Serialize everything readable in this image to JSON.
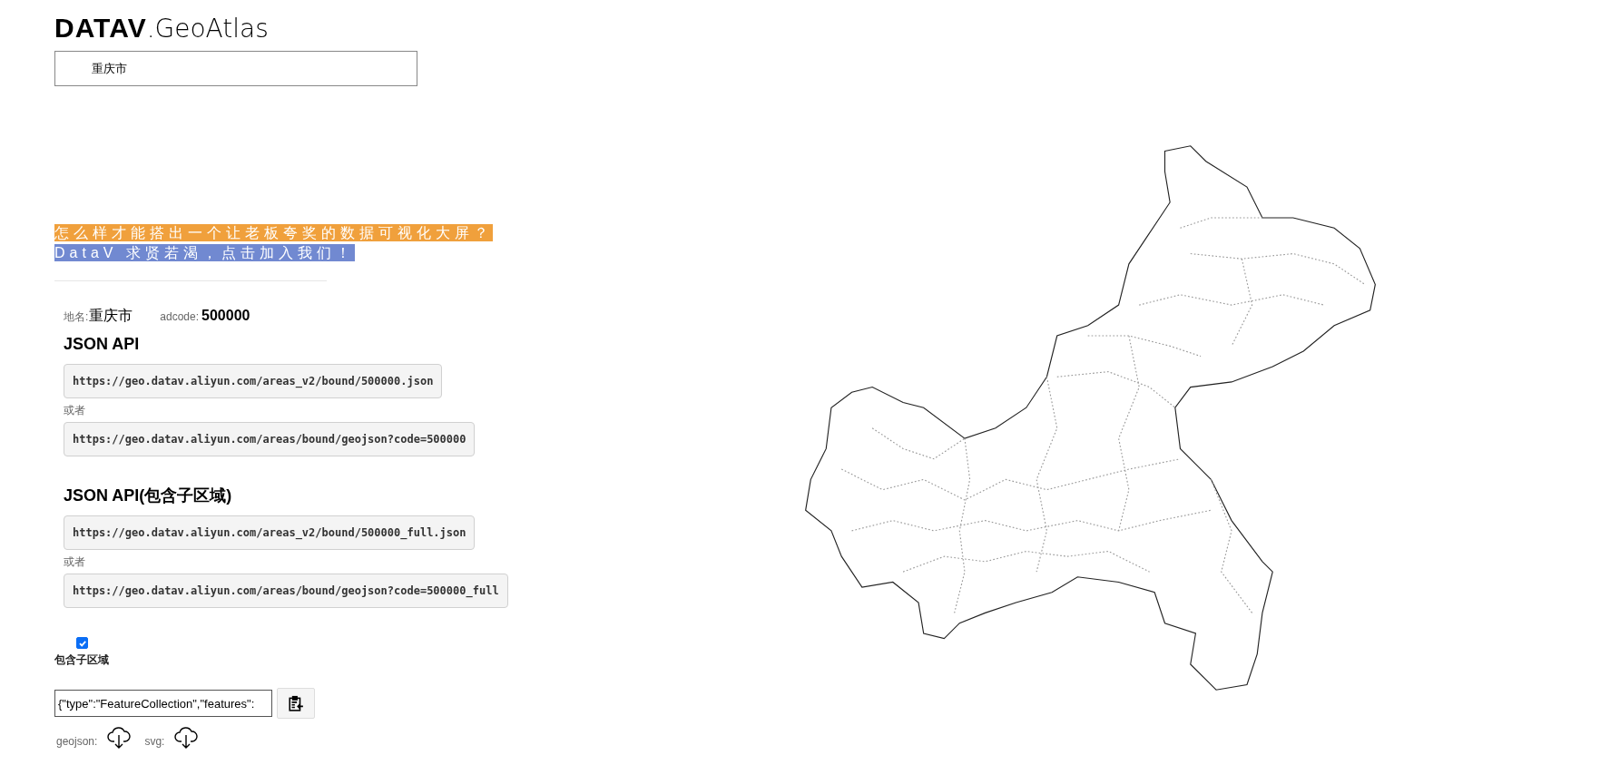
{
  "logo": {
    "bold": "DATAV",
    "light": ".GeoAtlas"
  },
  "search": {
    "value": "重庆市"
  },
  "banner": [
    {
      "text": "怎么样才能搭出一个让老板夸奖的数据可视化大屏？",
      "color": "#f0a03c"
    },
    {
      "text": "DataV 求贤若渴，点击加入我们！",
      "color": "#7189d1"
    }
  ],
  "info": {
    "name_label": "地名:",
    "name": "重庆市",
    "code_label": "adcode:",
    "code": "500000"
  },
  "sections": [
    {
      "heading": "JSON API",
      "items": [
        {
          "kind": "url",
          "text": "https://geo.datav.aliyun.com/areas_v2/bound/500000.json"
        },
        {
          "kind": "note",
          "text": "或者"
        },
        {
          "kind": "url",
          "text": "https://geo.datav.aliyun.com/areas/bound/geojson?code=500000"
        }
      ]
    },
    {
      "heading": "JSON API(包含子区域)",
      "items": [
        {
          "kind": "url",
          "text": "https://geo.datav.aliyun.com/areas_v2/bound/500000_full.json"
        },
        {
          "kind": "note",
          "text": "或者"
        },
        {
          "kind": "url",
          "text": "https://geo.datav.aliyun.com/areas/bound/geojson?code=500000_full"
        }
      ]
    }
  ],
  "checkbox": {
    "label": "包含子区域",
    "checked": true
  },
  "output": {
    "value": "{\"type\":\"FeatureCollection\",\"features\":"
  },
  "downloads": [
    {
      "label": "geojson:"
    },
    {
      "label": "svg:"
    }
  ]
}
